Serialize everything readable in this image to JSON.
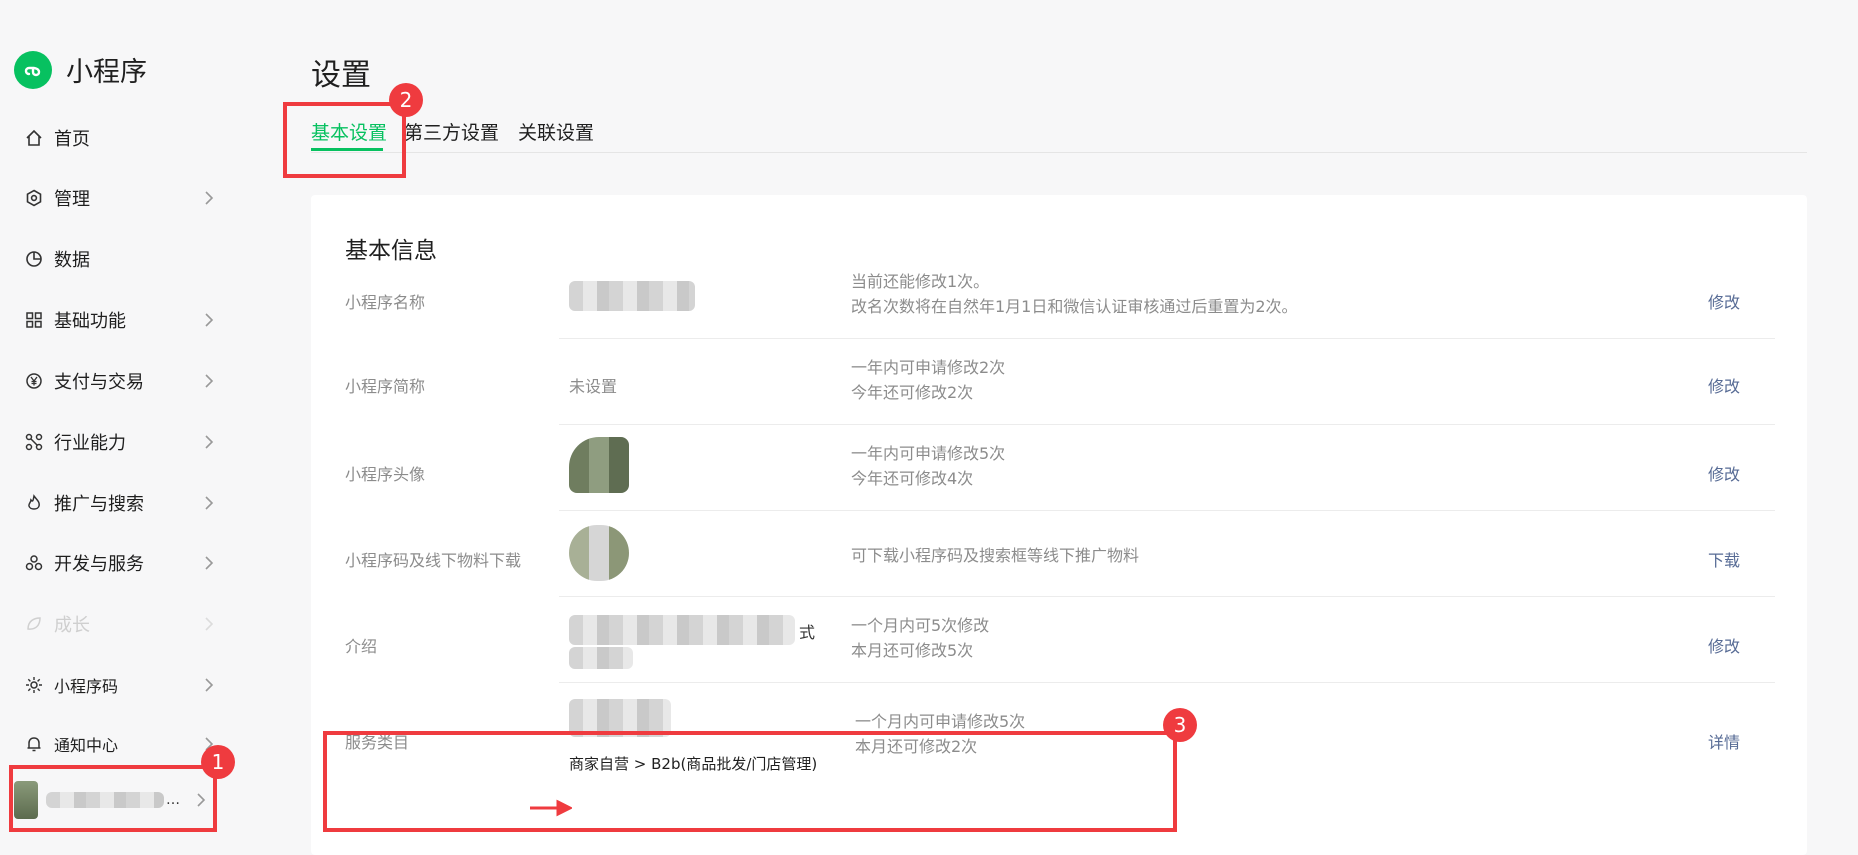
{
  "app": {
    "title": "小程序",
    "brand_color": "#07c160"
  },
  "sidebar": {
    "items": [
      {
        "label": "首页",
        "icon": "home-icon"
      },
      {
        "label": "管理",
        "icon": "hexagon-icon"
      },
      {
        "label": "数据",
        "icon": "pie-chart-icon"
      },
      {
        "label": "基础功能",
        "icon": "grid-icon"
      },
      {
        "label": "支付与交易",
        "icon": "yuan-icon"
      },
      {
        "label": "行业能力",
        "icon": "nodes-icon"
      },
      {
        "label": "推广与搜索",
        "icon": "flame-icon"
      },
      {
        "label": "开发与服务",
        "icon": "cluster-icon"
      },
      {
        "label": "成长",
        "icon": "leaf-icon"
      },
      {
        "label": "小程序码",
        "icon": "sun-icon"
      },
      {
        "label": "通知中心",
        "icon": "bell-icon"
      }
    ],
    "account_name_suffix": "…"
  },
  "page": {
    "title": "设置"
  },
  "tabs": [
    {
      "label": "基本设置",
      "active": true
    },
    {
      "label": "第三方设置",
      "active": false
    },
    {
      "label": "关联设置",
      "active": false
    }
  ],
  "card": {
    "title": "基本信息",
    "rows": [
      {
        "label": "小程序名称",
        "value": "",
        "desc1": "当前还能修改1次。",
        "desc2": "改名次数将在自然年1月1日和微信认证审核通过后重置为2次。",
        "action": "修改"
      },
      {
        "label": "小程序简称",
        "value": "未设置",
        "desc1": "一年内可申请修改2次",
        "desc2": "今年还可修改2次",
        "action": "修改"
      },
      {
        "label": "小程序头像",
        "value": "",
        "desc1": "一年内可申请修改5次",
        "desc2": "今年还可修改4次",
        "action": "修改"
      },
      {
        "label": "小程序码及线下物料下载",
        "value": "",
        "desc1": "可下载小程序码及搜索框等线下推广物料",
        "desc2": "",
        "action": "下载"
      },
      {
        "label": "介绍",
        "value": "式",
        "desc1": "一个月内可5次修改",
        "desc2": "本月还可修改5次",
        "action": "修改"
      },
      {
        "label": "服务类目",
        "value": "商家自营 > B2b(商品批发/门店管理)",
        "desc1": "一个月内可申请修改5次",
        "desc2": "本月还可修改2次",
        "action": "详情"
      }
    ]
  },
  "annotations": {
    "badge1": "1",
    "badge2": "2",
    "badge3": "3",
    "color": "#ef3b3f"
  }
}
